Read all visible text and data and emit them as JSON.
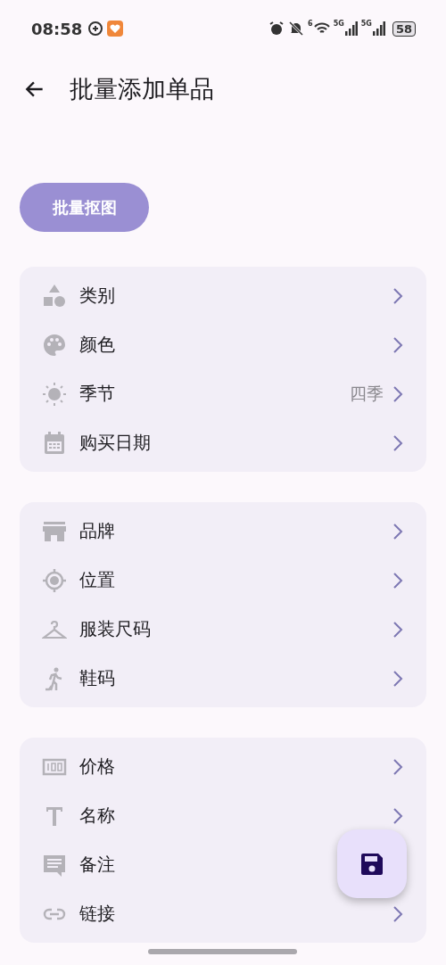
{
  "status_bar": {
    "time": "08:58",
    "wifi_label": "6",
    "signals": [
      "5G",
      "5G"
    ],
    "battery": "58"
  },
  "header": {
    "title": "批量添加单品"
  },
  "action_button": {
    "label": "批量抠图"
  },
  "groups": [
    {
      "items": [
        {
          "label": "类别"
        },
        {
          "label": "颜色"
        },
        {
          "label": "季节",
          "value": "四季"
        },
        {
          "label": "购买日期"
        }
      ]
    },
    {
      "items": [
        {
          "label": "品牌"
        },
        {
          "label": "位置"
        },
        {
          "label": "服装尺码"
        },
        {
          "label": "鞋码"
        }
      ]
    },
    {
      "items": [
        {
          "label": "价格"
        },
        {
          "label": "名称"
        },
        {
          "label": "备注",
          "chevron": false
        },
        {
          "label": "链接"
        }
      ]
    }
  ]
}
